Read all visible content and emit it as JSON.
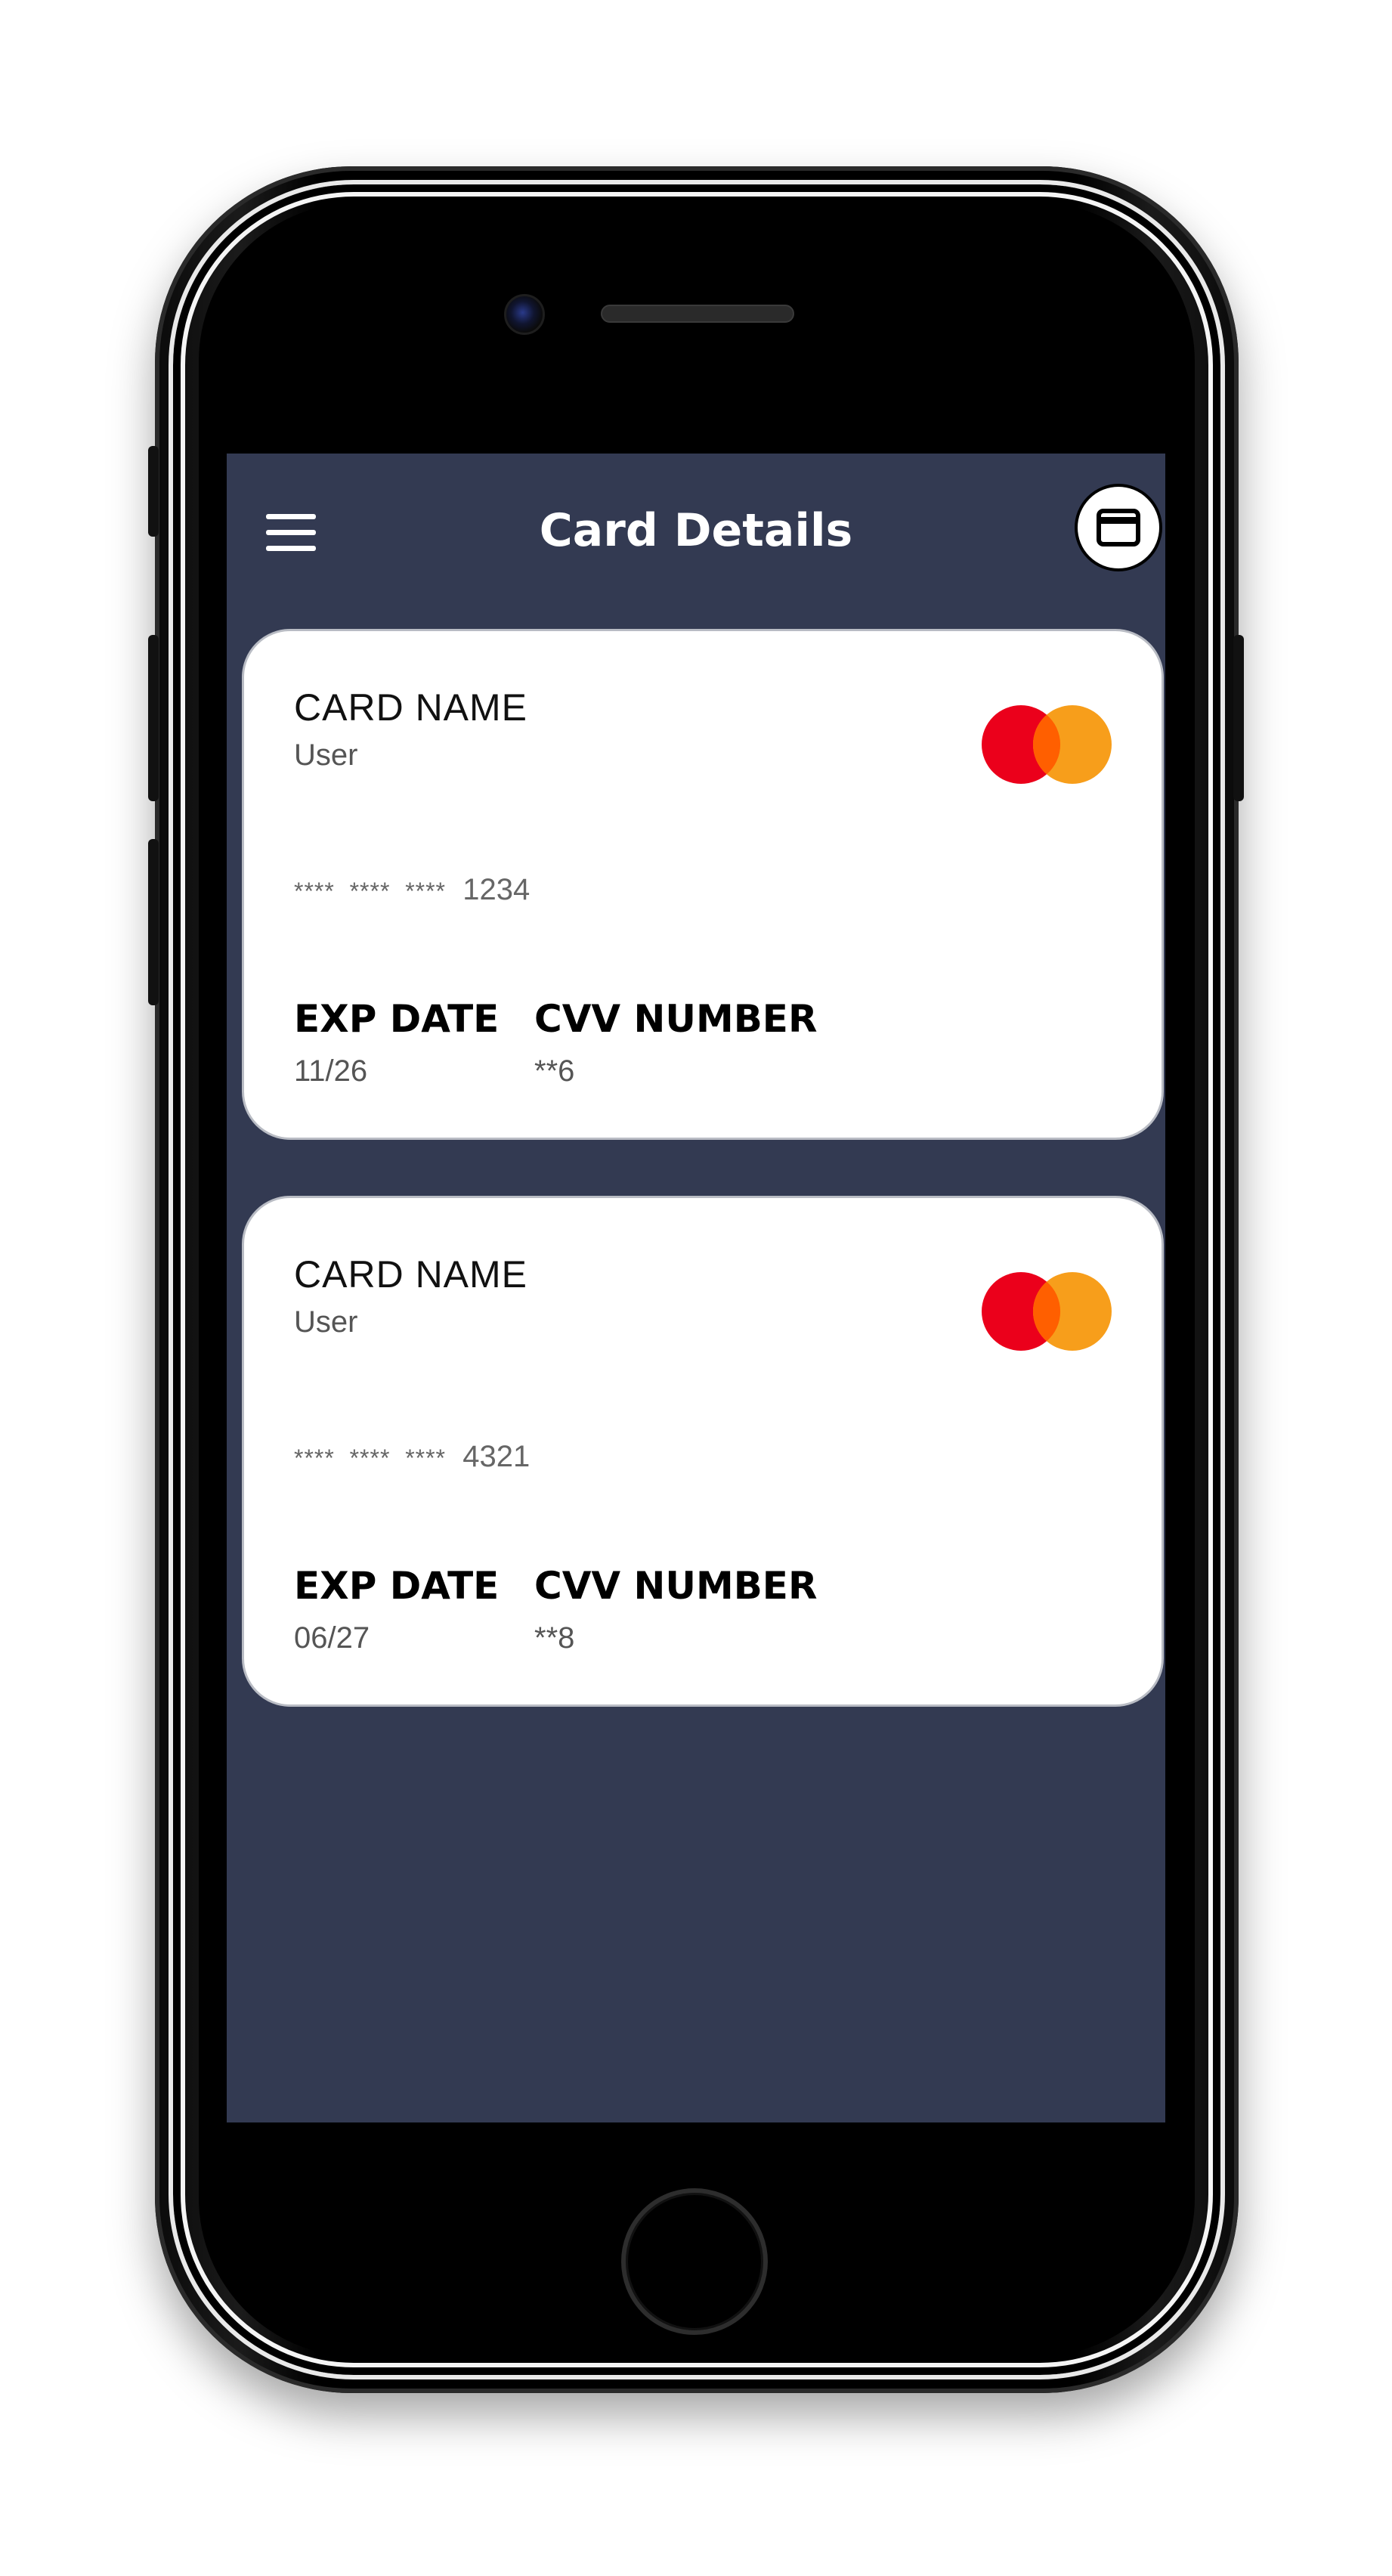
{
  "app": {
    "title": "Card Details"
  },
  "header": {
    "menu_icon": "hamburger-menu-icon",
    "card_action_icon": "credit-card-icon"
  },
  "cards": [
    {
      "name_label": "CARD NAME",
      "holder": "User",
      "mask": "****  ****  ****",
      "last4": "1234",
      "exp_label": "EXP DATE",
      "exp_value": "11/26",
      "cvv_label": "CVV NUMBER",
      "cvv_value": "**6",
      "brand_icon": "mastercard-logo-icon"
    },
    {
      "name_label": "CARD NAME",
      "holder": "User",
      "mask": "****  ****  ****",
      "last4": "4321",
      "exp_label": "EXP DATE",
      "exp_value": "06/27",
      "cvv_label": "CVV NUMBER",
      "cvv_value": "**8",
      "brand_icon": "mastercard-logo-icon"
    }
  ],
  "colors": {
    "screen_background": "#333a52",
    "card_background": "#ffffff",
    "brand_red": "#eb001b",
    "brand_orange": "#f79e1b",
    "brand_overlap": "#ff5f00"
  }
}
